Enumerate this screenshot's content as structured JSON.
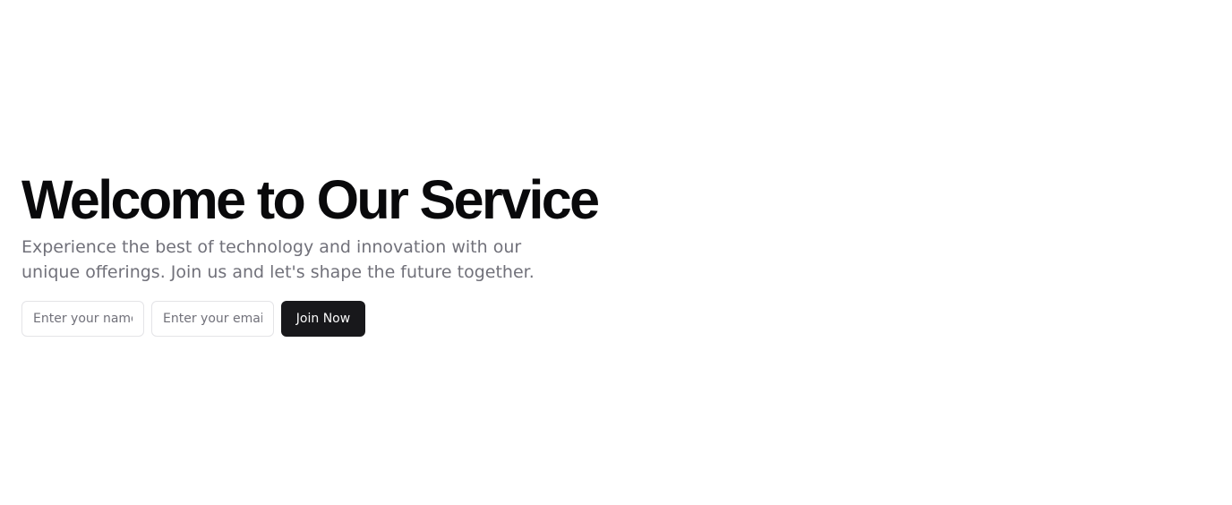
{
  "hero": {
    "title": "Welcome to Our Service",
    "subtitle": "Experience the best of technology and innovation with our unique offerings. Join us and let's shape the future together."
  },
  "form": {
    "name_placeholder": "Enter your name",
    "email_placeholder": "Enter your email",
    "submit_label": "Join Now"
  },
  "colors": {
    "title": "#09090b",
    "subtitle": "#71717a",
    "button_background": "#18181b",
    "button_text": "#fafafa",
    "input_border": "#e4e4e7"
  }
}
